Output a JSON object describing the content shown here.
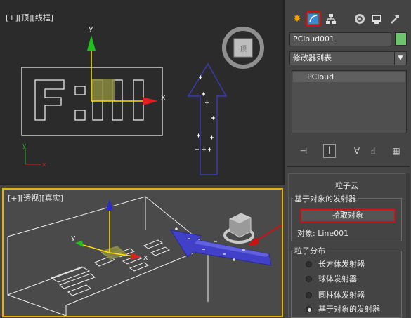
{
  "viewport_top": {
    "label_parts": [
      "[+]",
      "[顶]",
      "[线框]"
    ]
  },
  "viewport_persp": {
    "label_parts": [
      "[+]",
      "[透视]",
      "[真实]"
    ]
  },
  "gizmo": {
    "x_label": "x",
    "y_label": "y",
    "z_label": "z"
  },
  "panel": {
    "tabs": [
      "create-icon",
      "modify-icon",
      "hierarchy-icon",
      "motion-icon",
      "display-icon",
      "utilities-icon"
    ],
    "active_tab": 1,
    "object_name": "PCloud001",
    "object_color": "#6cc56c",
    "modifier_list": "修改器列表",
    "stack_items": [
      "PCloud"
    ],
    "rollout": {
      "title": "粒子云",
      "emitter_group": "基于对象的发射器",
      "pick_button": "拾取对象",
      "object_label": "对象: Line001",
      "distribution_group": "粒子分布",
      "options": [
        "长方体发射器",
        "球体发射器",
        "圆柱体发射器",
        "基于对象的发射器"
      ],
      "selected_option": 3
    }
  },
  "colors": {
    "highlight_red": "#d01010",
    "viewport_active_border": "#e8b000",
    "arrow_blue": "#3a3ab0"
  }
}
